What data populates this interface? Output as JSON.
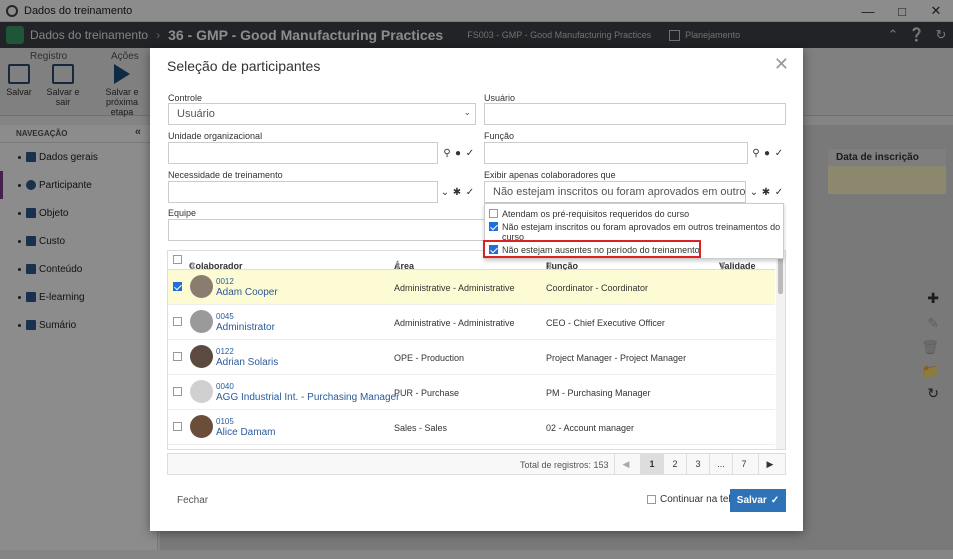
{
  "window": {
    "title": "Dados do treinamento"
  },
  "header": {
    "crumb": "Dados do treinamento",
    "title": "36 - GMP - Good Manufacturing Practices",
    "code": "FS003 - GMP - Good Manufacturing Practices",
    "phase": "Planejamento"
  },
  "ribbon": {
    "group_registro": "Registro",
    "group_acoes": "Ações",
    "salvar": "Salvar",
    "salvar_sair": "Salvar e sair",
    "salvar_proxima_1": "Salvar e",
    "salvar_proxima_2": "próxima etapa"
  },
  "sidebar": {
    "heading": "NAVEGAÇÃO",
    "items": [
      {
        "label": "Dados gerais"
      },
      {
        "label": "Participante"
      },
      {
        "label": "Objeto"
      },
      {
        "label": "Custo"
      },
      {
        "label": "Conteúdo"
      },
      {
        "label": "E-learning"
      },
      {
        "label": "Sumário"
      }
    ]
  },
  "background": {
    "col_data_inscricao": "Data de inscrição"
  },
  "modal": {
    "title": "Seleção de participantes",
    "controle_label": "Controle",
    "controle_value": "Usuário",
    "usuario_label": "Usuário",
    "unidade_label": "Unidade organizacional",
    "funcao_label": "Função",
    "necessidade_label": "Necessidade de treinamento",
    "exibir_label": "Exibir apenas colaboradores que",
    "exibir_value": "Não estejam inscritos ou foram aprovados em outros trei",
    "equipe_label": "Equipe",
    "options": [
      {
        "label": "Atendam os pré-requisitos requeridos do curso",
        "checked": false
      },
      {
        "label": "Não estejam inscritos ou foram aprovados em outros treinamentos do",
        "label2": "curso",
        "checked": true
      },
      {
        "label": "Não estejam ausentes no período do treinamento",
        "checked": true
      }
    ],
    "grid": {
      "headers": {
        "colaborador": "Colaborador",
        "area": "Área",
        "funcao": "Função",
        "validade": "Validade"
      },
      "rows": [
        {
          "code": "0012",
          "name": "Adam Cooper",
          "area": "Administrative - Administrative",
          "func": "Coordinator - Coordinator",
          "selected": true
        },
        {
          "code": "0045",
          "name": "Administrator",
          "area": "Administrative - Administrative",
          "func": "CEO - Chief Executive Officer",
          "selected": false
        },
        {
          "code": "0122",
          "name": "Adrian Solaris",
          "area": "OPE - Production",
          "func": "Project Manager - Project Manager",
          "selected": false
        },
        {
          "code": "0040",
          "name": "AGG Industrial Int. - Purchasing Manager",
          "area": "PUR - Purchase",
          "func": "PM - Purchasing Manager",
          "selected": false
        },
        {
          "code": "0105",
          "name": "Alice Damam",
          "area": "Sales - Sales",
          "func": "02 - Account manager",
          "selected": false
        }
      ]
    },
    "pager": {
      "total": "Total de registros: 153",
      "p1": "1",
      "p2": "2",
      "p3": "3",
      "ellipsis": "...",
      "p7": "7"
    },
    "fechar": "Fechar",
    "continuar": "Continuar na tela",
    "salvar": "Salvar"
  }
}
